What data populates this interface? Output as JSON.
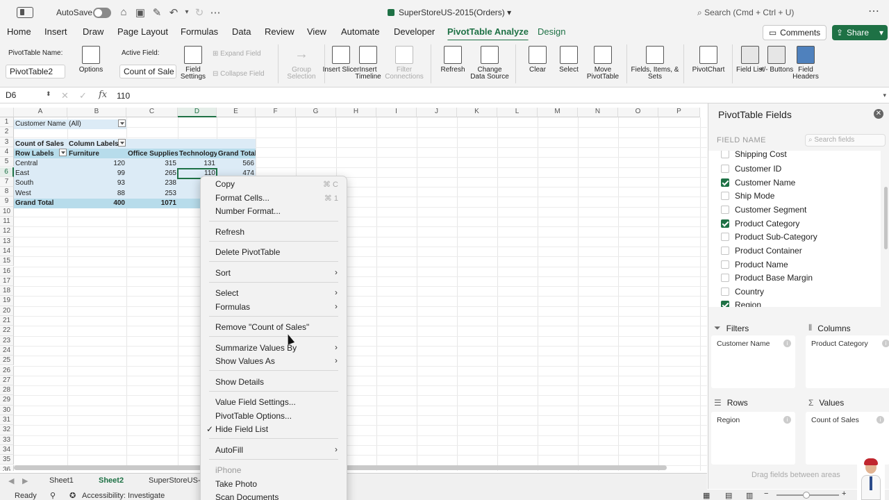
{
  "titlebar": {
    "autosave_label": "AutoSave",
    "document_title": "SuperStoreUS-2015(Orders)",
    "search_placeholder": "Search (Cmd + Ctrl + U)"
  },
  "menu": [
    "Home",
    "Insert",
    "Draw",
    "Page Layout",
    "Formulas",
    "Data",
    "Review",
    "View",
    "Automate",
    "Developer",
    "PivotTable Analyze",
    "Design"
  ],
  "menu_active": "PivotTable Analyze",
  "actions": {
    "comments": "Comments",
    "share": "Share"
  },
  "ribbon": {
    "pivot_name_label": "PivotTable Name:",
    "pivot_name_value": "PivotTable2",
    "options": "Options",
    "active_field_label": "Active Field:",
    "active_field_value": "Count of Sale",
    "field_settings": "Field Settings",
    "expand_field": "Expand Field",
    "collapse_field": "Collapse Field",
    "group_selection": "Group Selection",
    "insert_slicer": "Insert Slicer",
    "insert_timeline": "Insert Timeline",
    "filter_connections": "Filter Connections",
    "refresh": "Refresh",
    "change_data_source": "Change Data Source",
    "clear": "Clear",
    "select": "Select",
    "move_pivottable": "Move PivotTable",
    "fields_items_sets": "Fields, Items, & Sets",
    "pivotchart": "PivotChart",
    "field_list": "Field List",
    "plus_minus_buttons": "+/- Buttons",
    "field_headers": "Field Headers"
  },
  "formula_bar": {
    "cell_ref": "D6",
    "fx": "fx",
    "value": "110"
  },
  "columns": [
    "A",
    "B",
    "C",
    "D",
    "E",
    "F",
    "G",
    "H",
    "I",
    "J",
    "K",
    "L",
    "M",
    "N",
    "O",
    "P"
  ],
  "rows": [
    "1",
    "2",
    "3",
    "4",
    "5",
    "6",
    "7",
    "8",
    "9",
    "10",
    "11",
    "12",
    "13",
    "14",
    "15",
    "16",
    "17",
    "18",
    "19",
    "20",
    "21",
    "22",
    "23",
    "24",
    "25",
    "26",
    "27",
    "28",
    "29",
    "30",
    "31",
    "32",
    "33",
    "34",
    "35",
    "36"
  ],
  "pivot": {
    "filter_label": "Customer Name",
    "filter_value": "(All)",
    "count_label": "Count of Sales",
    "column_labels": "Column Labels",
    "row_labels": "Row Labels",
    "col_headers": [
      "Furniture",
      "Office Supplies",
      "Technology",
      "Grand Total"
    ],
    "data_rows": [
      {
        "label": "Central",
        "values": [
          "120",
          "315",
          "131",
          "566"
        ]
      },
      {
        "label": "East",
        "values": [
          "99",
          "265",
          "110",
          "474"
        ]
      },
      {
        "label": "South",
        "values": [
          "93",
          "238",
          "",
          ""
        ]
      },
      {
        "label": "West",
        "values": [
          "88",
          "253",
          "",
          ""
        ]
      }
    ],
    "grand_total": {
      "label": "Grand Total",
      "values": [
        "400",
        "1071"
      ]
    }
  },
  "context_menu": {
    "copy": "Copy",
    "copy_shortcut": "⌘ C",
    "format_cells": "Format Cells...",
    "format_cells_shortcut": "⌘ 1",
    "number_format": "Number Format...",
    "refresh": "Refresh",
    "delete_pivottable": "Delete PivotTable",
    "sort": "Sort",
    "select": "Select",
    "formulas": "Formulas",
    "remove": "Remove \"Count of Sales\"",
    "summarize": "Summarize Values By",
    "show_values_as": "Show Values As",
    "show_details": "Show Details",
    "value_field_settings": "Value Field Settings...",
    "pivot_options": "PivotTable Options...",
    "hide_field_list": "Hide Field List",
    "autofill": "AutoFill",
    "iphone": "iPhone",
    "take_photo": "Take Photo",
    "scan_documents": "Scan Documents"
  },
  "sheets": [
    "Sheet1",
    "Sheet2",
    "SuperStoreUS-"
  ],
  "active_sheet": "Sheet2",
  "status": {
    "ready": "Ready",
    "accessibility": "Accessibility: Investigate"
  },
  "pane": {
    "title": "PivotTable Fields",
    "field_name_label": "FIELD NAME",
    "search_placeholder": "Search fields",
    "fields": [
      {
        "name": "Shipping Cost",
        "checked": false
      },
      {
        "name": "Customer ID",
        "checked": false
      },
      {
        "name": "Customer Name",
        "checked": true
      },
      {
        "name": "Ship Mode",
        "checked": false
      },
      {
        "name": "Customer Segment",
        "checked": false
      },
      {
        "name": "Product Category",
        "checked": true
      },
      {
        "name": "Product Sub-Category",
        "checked": false
      },
      {
        "name": "Product Container",
        "checked": false
      },
      {
        "name": "Product Name",
        "checked": false
      },
      {
        "name": "Product Base Margin",
        "checked": false
      },
      {
        "name": "Country",
        "checked": false
      },
      {
        "name": "Region",
        "checked": true
      }
    ],
    "filters": "Filters",
    "filters_item": "Customer Name",
    "columns": "Columns",
    "columns_item": "Product Category",
    "rows": "Rows",
    "rows_item": "Region",
    "values": "Values",
    "values_item": "Count of Sales",
    "drag_note": "Drag fields between areas"
  },
  "colors": {
    "accent": "#1e7145",
    "pivot_band": "#b7dceb",
    "pivot_bg": "#dcebf6"
  }
}
